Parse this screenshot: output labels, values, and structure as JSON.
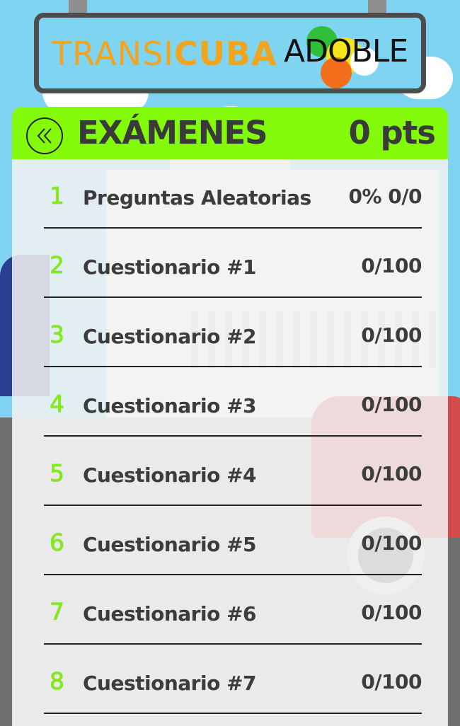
{
  "app": {
    "brand_light": "TRANSI",
    "brand_bold": "CUBA",
    "partner": "ADOBLE",
    "brand_color": "#f2a51c",
    "accent_color": "#82fa0a"
  },
  "header": {
    "back_icon": "double-chevron-left-icon",
    "title": "EXÁMENES",
    "points": "0 pts"
  },
  "exams": [
    {
      "number": "1",
      "label": "Preguntas Aleatorias",
      "score": "0% 0/0"
    },
    {
      "number": "2",
      "label": "Cuestionario #1",
      "score": "0/100"
    },
    {
      "number": "3",
      "label": "Cuestionario #2",
      "score": "0/100"
    },
    {
      "number": "4",
      "label": "Cuestionario #3",
      "score": "0/100"
    },
    {
      "number": "5",
      "label": "Cuestionario #4",
      "score": "0/100"
    },
    {
      "number": "6",
      "label": "Cuestionario #5",
      "score": "0/100"
    },
    {
      "number": "7",
      "label": "Cuestionario #6",
      "score": "0/100"
    },
    {
      "number": "8",
      "label": "Cuestionario #7",
      "score": "0/100"
    }
  ]
}
